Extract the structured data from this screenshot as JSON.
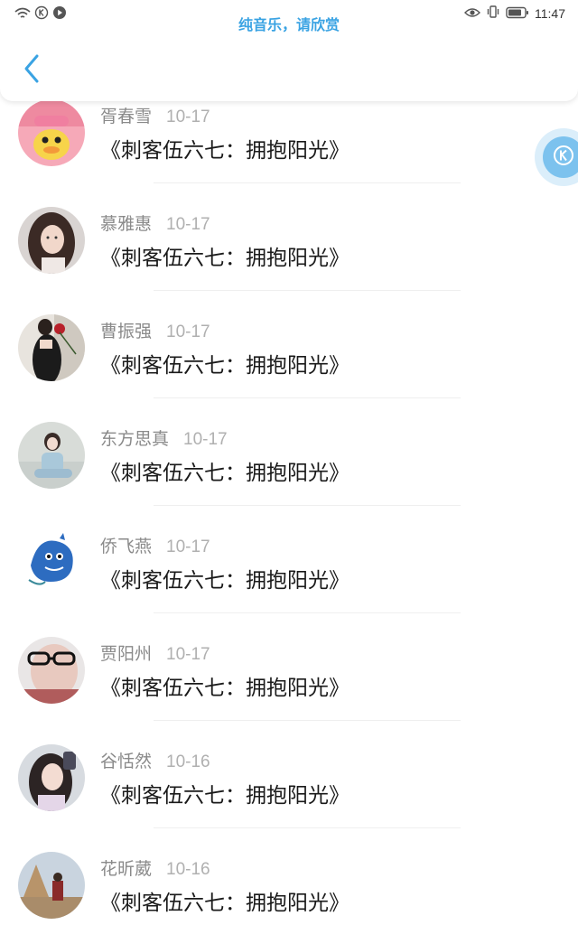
{
  "status_bar": {
    "time": "11:47",
    "icons": [
      "wifi-icon",
      "k-app-icon",
      "play-icon",
      "eye-icon",
      "vibrate-icon",
      "battery-icon"
    ]
  },
  "header": {
    "title": "纯音乐，请欣赏",
    "back_icon": "chevron-left-icon"
  },
  "colors": {
    "accent": "#3aa3e3",
    "name_text": "#8a8a8a",
    "date_text": "#b0b0b0",
    "title_text": "#1a1a1a"
  },
  "comments": [
    {
      "name": "胥春雪",
      "date": "10-17",
      "title": "《刺客伍六七：拥抱阳光》"
    },
    {
      "name": "慕雅惠",
      "date": "10-17",
      "title": "《刺客伍六七：拥抱阳光》"
    },
    {
      "name": "曹振强",
      "date": "10-17",
      "title": "《刺客伍六七：拥抱阳光》"
    },
    {
      "name": "东方思真",
      "date": "10-17",
      "title": "《刺客伍六七：拥抱阳光》"
    },
    {
      "name": "侨飞燕",
      "date": "10-17",
      "title": "《刺客伍六七：拥抱阳光》"
    },
    {
      "name": "贾阳州",
      "date": "10-17",
      "title": "《刺客伍六七：拥抱阳光》"
    },
    {
      "name": "谷恬然",
      "date": "10-16",
      "title": "《刺客伍六七：拥抱阳光》"
    },
    {
      "name": "花昕葳",
      "date": "10-16",
      "title": "《刺客伍六七：拥抱阳光》"
    }
  ],
  "float_widget": {
    "icon": "k-app-icon"
  }
}
